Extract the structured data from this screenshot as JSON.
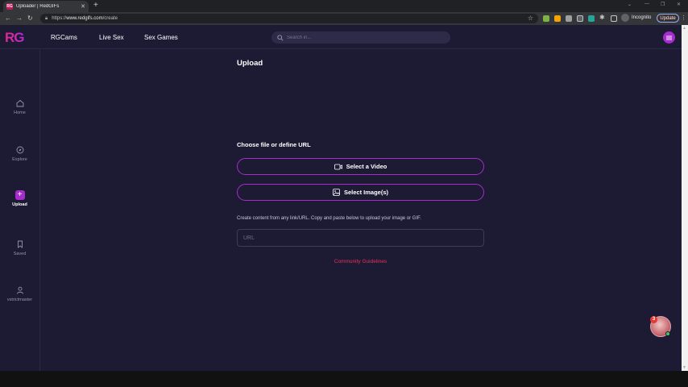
{
  "browser": {
    "tab_title": "Uploader | RedGIFs",
    "tab_favicon_text": "RG",
    "url_prefix": "https://",
    "url_domain": "www.redgifs.com",
    "url_path": "/create",
    "incognito_label": "Incognito",
    "update_label": "Update"
  },
  "header": {
    "logo": "RG",
    "nav": [
      "RGCams",
      "Live Sex",
      "Sex Games"
    ],
    "search_placeholder": "Search in..."
  },
  "sidebar": {
    "items": [
      {
        "label": "Home",
        "icon": "home-icon"
      },
      {
        "label": "Explore",
        "icon": "compass-icon"
      },
      {
        "label": "Upload",
        "icon": "plus-icon",
        "active": true
      },
      {
        "label": "Saved",
        "icon": "bookmark-icon"
      },
      {
        "label": "vstrictmaster",
        "icon": "user-icon"
      }
    ]
  },
  "main": {
    "title": "Upload",
    "choose_label": "Choose file or define URL",
    "select_video": "Select a Video",
    "select_images": "Select Image(s)",
    "hint": "Create content from any link/URL. Copy and paste below to upload your image or GIF.",
    "url_placeholder": "URL",
    "guidelines": "Community Guidelines"
  },
  "chat": {
    "badge_count": "3"
  },
  "colors": {
    "accent": "#a62ccd",
    "background": "#1d1b33",
    "link_red": "#e8315b"
  }
}
